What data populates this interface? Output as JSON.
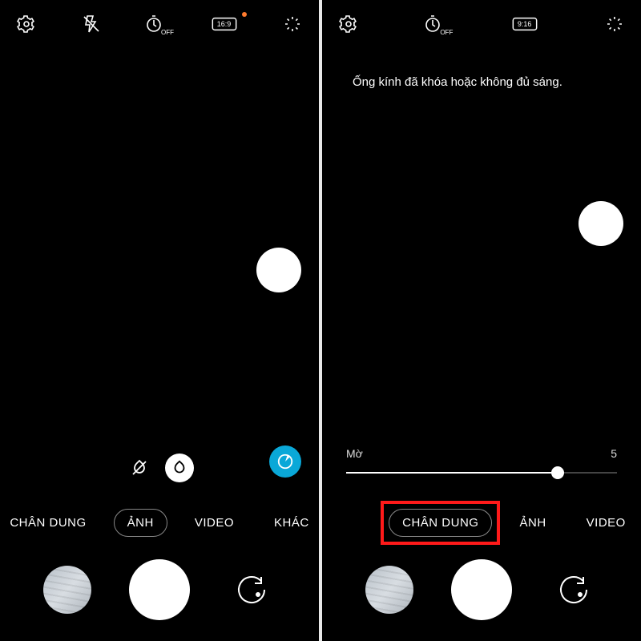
{
  "left": {
    "topbar": {
      "settings": "settings",
      "flash": "flash-off",
      "timer": "OFF",
      "ratio": "16:9",
      "ratio_dot": true,
      "magic": "magic"
    },
    "modes": {
      "items": [
        "CHÂN DUNG",
        "ẢNH",
        "VIDEO",
        "KHÁC"
      ],
      "selected_index": 1
    }
  },
  "right": {
    "topbar": {
      "settings": "settings",
      "timer": "OFF",
      "ratio": "9:16",
      "magic": "magic"
    },
    "warning": "Ống kính đã khóa hoặc không đủ sáng.",
    "slider": {
      "left_label": "Mờ",
      "right_label": "5",
      "value_pct": 78
    },
    "modes": {
      "items": [
        "CHÂN DUNG",
        "ẢNH",
        "VIDEO"
      ],
      "selected_index": 0
    }
  }
}
